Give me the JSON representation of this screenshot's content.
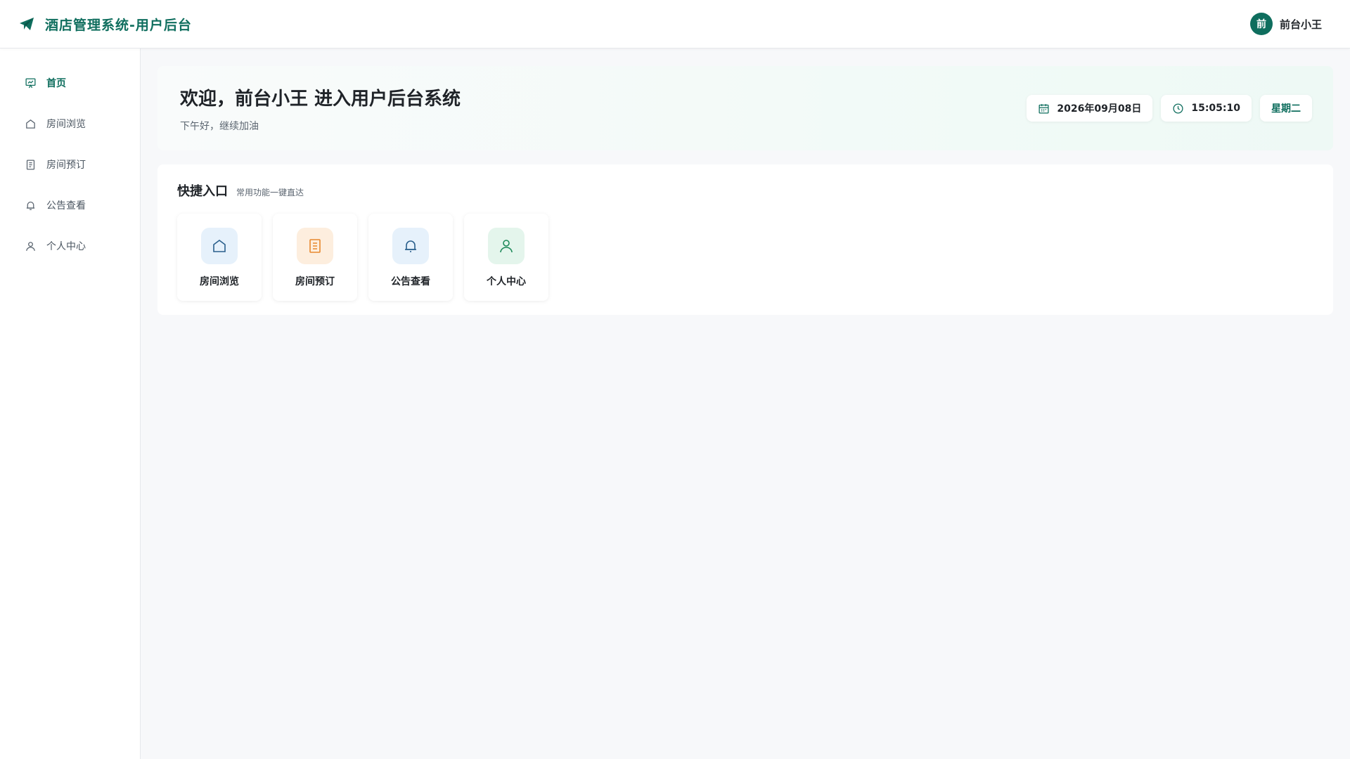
{
  "app": {
    "title": "酒店管理系统-用户后台",
    "user_name": "前台小王",
    "avatar_text": "前"
  },
  "colors": {
    "brand": "#0f6e5e",
    "house_icon": "#2a5f8c",
    "order_icon": "#e8892e",
    "bell_icon": "#2a5f8c",
    "user_icon": "#1e8a5a"
  },
  "sidebar": {
    "items": [
      {
        "label": "首页",
        "icon": "dashboard-icon",
        "active": true
      },
      {
        "label": "房间浏览",
        "icon": "house-icon"
      },
      {
        "label": "房间预订",
        "icon": "document-icon"
      },
      {
        "label": "公告查看",
        "icon": "bell-icon"
      },
      {
        "label": "个人中心",
        "icon": "user-icon"
      }
    ]
  },
  "welcome": {
    "title": "欢迎，前台小王 进入用户后台系统",
    "subtitle": "下午好，继续加油",
    "date": "2026年09月08日",
    "time": "15:05:10",
    "weekday": "星期二"
  },
  "quick": {
    "title": "快捷入口",
    "subtitle": "常用功能一键直达",
    "cards": [
      {
        "label": "房间浏览",
        "icon": "house-icon"
      },
      {
        "label": "房间预订",
        "icon": "document-icon"
      },
      {
        "label": "公告查看",
        "icon": "bell-icon"
      },
      {
        "label": "个人中心",
        "icon": "user-icon"
      }
    ]
  }
}
